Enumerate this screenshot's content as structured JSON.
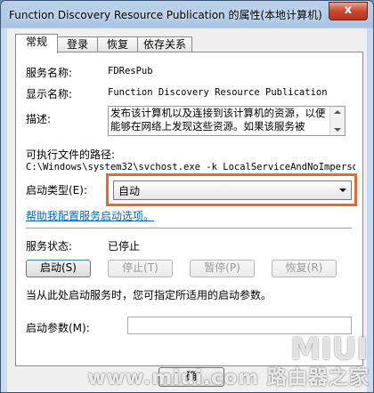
{
  "window": {
    "title": "Function Discovery Resource Publication 的属性(本地计算机)",
    "close_glyph": "x"
  },
  "tabs": [
    {
      "label": "常规"
    },
    {
      "label": "登录"
    },
    {
      "label": "恢复"
    },
    {
      "label": "依存关系"
    }
  ],
  "general": {
    "service_name_label": "服务名称:",
    "service_name_value": "FDResPub",
    "display_name_label": "显示名称:",
    "display_name_value": "Function Discovery Resource Publication",
    "description_label": "描述:",
    "description_value": "发布该计算机以及连接到该计算机的资源，以便能够在网络上发现这些资源。如果该服务被",
    "exe_path_label": "可执行文件的路径:",
    "exe_path_value": "C:\\Windows\\system32\\svchost.exe -k LocalServiceAndNoImpersor",
    "startup_type_label": "启动类型(E):",
    "startup_type_value": "自动",
    "help_link": "帮助我配置服务启动选项。",
    "status_label": "服务状态:",
    "status_value": "已停止",
    "buttons": {
      "start": "启动(S)",
      "stop": "停止(T)",
      "pause": "暂停(P)",
      "resume": "恢复(R)"
    },
    "hint": "当从此处启动服务时，您可指定所适用的启动参数。",
    "params_label": "启动参数(M):",
    "params_value": ""
  },
  "footer": {
    "ok_partial": "确",
    "watermark_top": "MIUI",
    "watermark_bottom": "www.miui.com 路由器之家"
  },
  "colors": {
    "highlight": "#e8692f",
    "link": "#0066cc"
  }
}
